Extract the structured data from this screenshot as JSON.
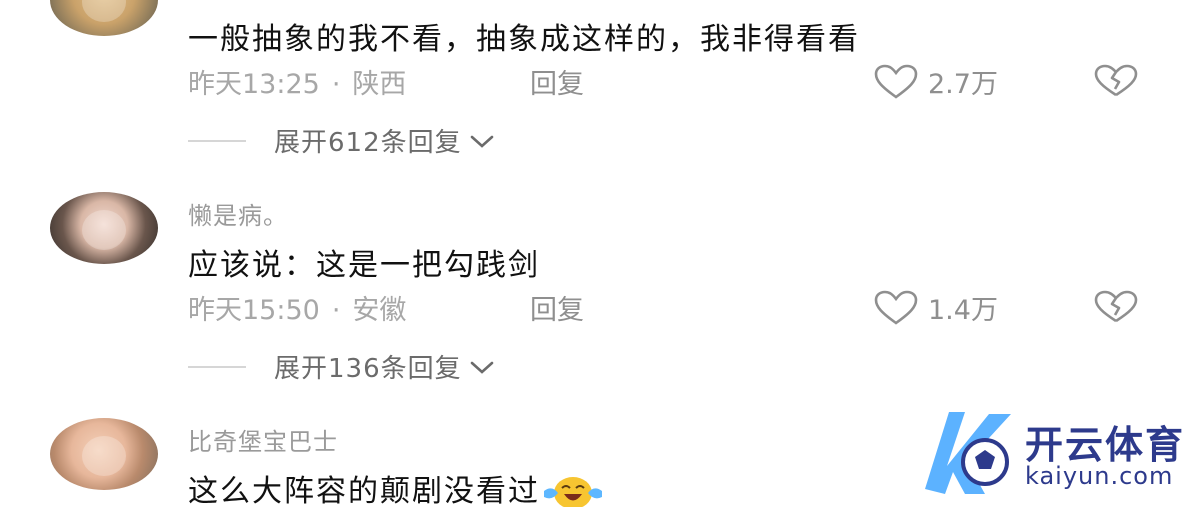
{
  "comments": [
    {
      "username": "",
      "text": "一般抽象的我不看，抽象成这样的，我非得看看",
      "time": "昨天13:25",
      "location": "陕西",
      "reply_label": "回复",
      "likes": "2.7万",
      "expand_label": "展开612条回复"
    },
    {
      "username": "懒是病。",
      "text": "应该说：这是一把勾践剑",
      "time": "昨天15:50",
      "location": "安徽",
      "reply_label": "回复",
      "likes": "1.4万",
      "expand_label": "展开136条回复"
    },
    {
      "username": "比奇堡宝巴士",
      "text": "这么大阵容的颠剧没看过",
      "emoji": "crying-laughing-emoji"
    }
  ],
  "brand": {
    "name": "开云体育",
    "domain": "kaiyun.com",
    "color": "#2d3a8c",
    "accent": "#3fa4ff"
  }
}
